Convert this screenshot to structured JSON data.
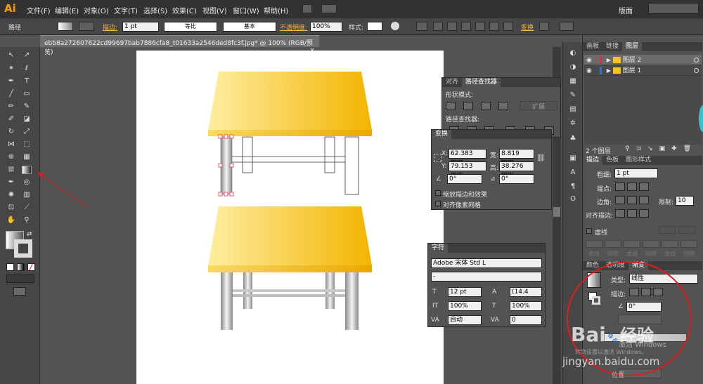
{
  "app": {
    "logo": "Ai",
    "workspace": "版面"
  },
  "menu": [
    "文件(F)",
    "编辑(E)",
    "对象(O)",
    "文字(T)",
    "选择(S)",
    "效果(C)",
    "视图(V)",
    "窗口(W)",
    "帮助(H)"
  ],
  "control": {
    "selection": "路径",
    "stroke_label": "描边:",
    "stroke_value": "1 pt",
    "profile": "等比",
    "brush": "基本",
    "opacity_label": "不透明度:",
    "opacity_value": "100%",
    "style_label": "样式:",
    "transform": "变换"
  },
  "document": {
    "tab": "ebb8a272607622cd99697bab7886cfa8_t01633a2546ded8fc3f.jpg* @ 100% (RGB/预览)"
  },
  "pathfinder": {
    "tabs": [
      "对齐",
      "路径查找器"
    ],
    "shape_modes": "形状模式:",
    "expand": "扩展",
    "pathfinders": "路径查找器:"
  },
  "transform": {
    "tab": "变换",
    "x_label": "X:",
    "x": "62.383 mm",
    "w_label": "宽:",
    "w": "8.819 mm",
    "y_label": "Y:",
    "y": "79.153 mm",
    "h_label": "高:",
    "h": "38.276 mm",
    "angle": "0°",
    "shear": "0°",
    "scale_strokes": "缩放描边和效果",
    "align_pixel": "对齐像素网格"
  },
  "character": {
    "tab": "字符",
    "font": "Adobe 宋体 Std L",
    "style": "-",
    "size": "12 pt",
    "leading": "(14.4",
    "scale_v": "100%",
    "scale_h": "100%",
    "tracking": "自动",
    "kerning": "0"
  },
  "layers": {
    "tabs": [
      "画板",
      "链接",
      "图层"
    ],
    "items": [
      "图层 2",
      "图层 1"
    ],
    "count": "2 个图层"
  },
  "stroke_panel": {
    "tabs": [
      "描边",
      "色板",
      "图形样式"
    ],
    "weight_label": "粗细:",
    "weight": "1 pt",
    "cap_label": "端点:",
    "corner_label": "边角:",
    "limit_label": "限制:",
    "limit": "10",
    "align_label": "对齐描边:",
    "dashed_label": "虚线",
    "dash_labels": [
      "虚线",
      "间隙",
      "虚线",
      "间隙",
      "虚线",
      "间隙"
    ]
  },
  "gradient_panel": {
    "tabs": [
      "颜色",
      "透明度",
      "渐变"
    ],
    "type_label": "类型:",
    "type": "线性",
    "stroke_label": "描边:",
    "angle": "0°"
  },
  "watermark": {
    "brand": "Bai",
    "brand2": "经验",
    "url": "jingyan.baidu.com",
    "activate": "激活 Windows",
    "settings": "转到设置以激活 Windows。",
    "extra": "位置"
  },
  "colors": {
    "accent": "#ff9a00",
    "annotation": "#e01b1b",
    "table_top": "#f5c518",
    "window": "#535353"
  }
}
